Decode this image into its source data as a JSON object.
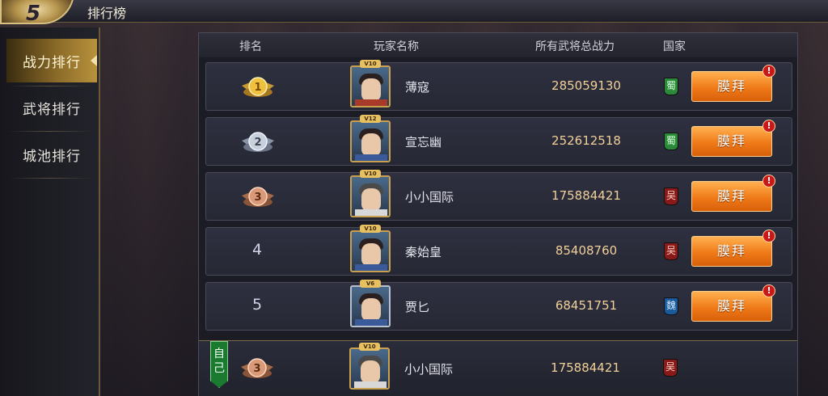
{
  "page": {
    "title": "排行榜",
    "logo_glyph": "5"
  },
  "sidebar": {
    "items": [
      {
        "label": "战力排行",
        "active": true
      },
      {
        "label": "武将排行",
        "active": false
      },
      {
        "label": "城池排行",
        "active": false
      }
    ]
  },
  "table": {
    "headers": {
      "rank": "排名",
      "player": "玩家名称",
      "power": "所有武将总战力",
      "nation": "国家"
    },
    "worship_label": "膜拜",
    "alert_glyph": "!",
    "rows": [
      {
        "rank": "1",
        "medal": "gold",
        "vip": "V10",
        "name": "薄寇",
        "power": "285059130",
        "nation": "蜀",
        "avatar_style": "red"
      },
      {
        "rank": "2",
        "medal": "silver",
        "vip": "V12",
        "name": "宣忘幽",
        "power": "252612518",
        "nation": "蜀",
        "avatar_style": "blue"
      },
      {
        "rank": "3",
        "medal": "bronze",
        "vip": "V10",
        "name": "小小国际",
        "power": "175884421",
        "nation": "吴",
        "avatar_style": "white"
      },
      {
        "rank": "4",
        "medal": "",
        "vip": "V10",
        "name": "秦始皇",
        "power": "85408760",
        "nation": "吴",
        "avatar_style": "blue"
      },
      {
        "rank": "5",
        "medal": "",
        "vip": "V6",
        "name": "贾匕",
        "power": "68451751",
        "nation": "魏",
        "avatar_style": "blue"
      }
    ],
    "self": {
      "tag": "自己",
      "rank": "3",
      "medal": "bronze",
      "vip": "V10",
      "name": "小小国际",
      "power": "175884421",
      "nation": "吴"
    }
  }
}
